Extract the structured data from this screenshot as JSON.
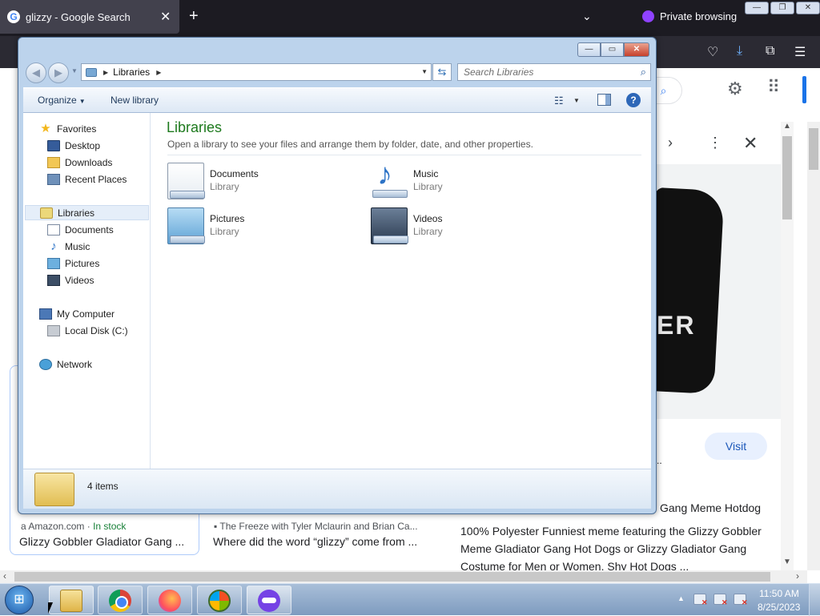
{
  "browser": {
    "tab_title": "glizzy - Google Search",
    "google_favicon_letter": "G",
    "private_label": "Private browsing",
    "accent": "#8f42ff"
  },
  "google": {
    "visit_label": "Visit",
    "result_title_fragment": "Gang Meme Hotdog",
    "description": "100% Polyester Funniest meme featuring the Glizzy Gobbler Meme Gladiator Gang Hot Dogs or Glizzy Gladiator Gang Costume for Men or Women. Shy Hot Dogs ...",
    "pillow_text": "ER",
    "cards": [
      {
        "source": "Amazon.com",
        "stock": "In stock",
        "title": "Glizzy Gobbler Gladiator Gang ..."
      },
      {
        "source": "The Freeze with Tyler Mclaurin and Brian Ca...",
        "title": "Where did the word “glizzy” come from ..."
      }
    ]
  },
  "explorer": {
    "address": "Libraries",
    "search_placeholder": "Search Libraries",
    "toolbar": {
      "organize": "Organize",
      "new_library": "New library"
    },
    "nav": {
      "favorites": "Favorites",
      "favorites_items": [
        "Desktop",
        "Downloads",
        "Recent Places"
      ],
      "libraries": "Libraries",
      "libraries_items": [
        "Documents",
        "Music",
        "Pictures",
        "Videos"
      ],
      "computer": "My Computer",
      "computer_items": [
        "Local Disk (C:)"
      ],
      "network": "Network"
    },
    "content": {
      "title": "Libraries",
      "subtitle": "Open a library to see your files and arrange them by folder, date, and other properties.",
      "libraries": [
        {
          "name": "Documents",
          "type": "Library"
        },
        {
          "name": "Music",
          "type": "Library"
        },
        {
          "name": "Pictures",
          "type": "Library"
        },
        {
          "name": "Videos",
          "type": "Library"
        }
      ]
    },
    "details": {
      "count": "4 items"
    },
    "title_color": "#1e7a1e"
  },
  "taskbar": {
    "time": "11:50 AM",
    "date": "8/25/2023",
    "apps": [
      "windows-explorer",
      "google-chrome",
      "firefox",
      "windows-media-center",
      "firefox-private"
    ]
  }
}
